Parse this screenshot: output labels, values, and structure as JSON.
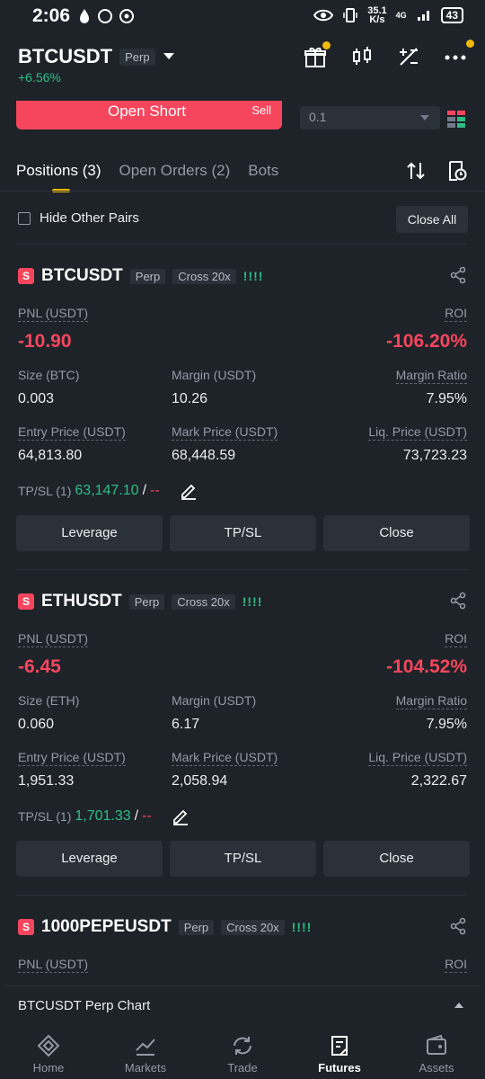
{
  "status_bar": {
    "time": "2:06",
    "speed": "35.1",
    "speed_unit": "K/s",
    "network": "4G",
    "battery": "43"
  },
  "header": {
    "symbol": "BTCUSDT",
    "type_tag": "Perp",
    "change": "+6.56%"
  },
  "order": {
    "open_short_label": "Open Short",
    "sell_label": "Sell",
    "quantity": "0.1"
  },
  "tabs": [
    {
      "label": "Positions (3)"
    },
    {
      "label": "Open Orders (2)"
    },
    {
      "label": "Bots"
    }
  ],
  "filter": {
    "hide_other_pairs": "Hide Other Pairs",
    "close_all": "Close All"
  },
  "labels": {
    "pnl": "PNL (USDT)",
    "roi": "ROI",
    "margin": "Margin (USDT)",
    "margin_ratio": "Margin Ratio",
    "entry": "Entry Price (USDT)",
    "mark": "Mark Price (USDT)",
    "liq": "Liq. Price (USDT)",
    "tpsl": "TP/SL (1)",
    "leverage_btn": "Leverage",
    "tpsl_btn": "TP/SL",
    "close_btn": "Close",
    "perp": "Perp",
    "cross": "Cross 20x",
    "bars": "!!!!",
    "side": "S",
    "sep": "/",
    "dashes": "--"
  },
  "positions": [
    {
      "symbol": "BTCUSDT",
      "size_label": "Size (BTC)",
      "pnl": "-10.90",
      "roi": "-106.20%",
      "size": "0.003",
      "margin": "10.26",
      "margin_ratio": "7.95%",
      "entry": "64,813.80",
      "mark": "68,448.59",
      "liq": "73,723.23",
      "tp": "63,147.10"
    },
    {
      "symbol": "ETHUSDT",
      "size_label": "Size (ETH)",
      "pnl": "-6.45",
      "roi": "-104.52%",
      "size": "0.060",
      "margin": "6.17",
      "margin_ratio": "7.95%",
      "entry": "1,951.33",
      "mark": "2,058.94",
      "liq": "2,322.67",
      "tp": "1,701.33"
    },
    {
      "symbol": "1000PEPEUSDT"
    }
  ],
  "chart_bar": {
    "label": "BTCUSDT Perp Chart"
  },
  "nav": [
    {
      "label": "Home",
      "icon": "home-icon"
    },
    {
      "label": "Markets",
      "icon": "markets-icon"
    },
    {
      "label": "Trade",
      "icon": "trade-icon"
    },
    {
      "label": "Futures",
      "icon": "futures-icon"
    },
    {
      "label": "Assets",
      "icon": "assets-icon"
    }
  ],
  "colors": {
    "accent": "#f0b90b",
    "sell": "#f6465d",
    "buy": "#2ebd85",
    "bg": "#1e2329"
  }
}
